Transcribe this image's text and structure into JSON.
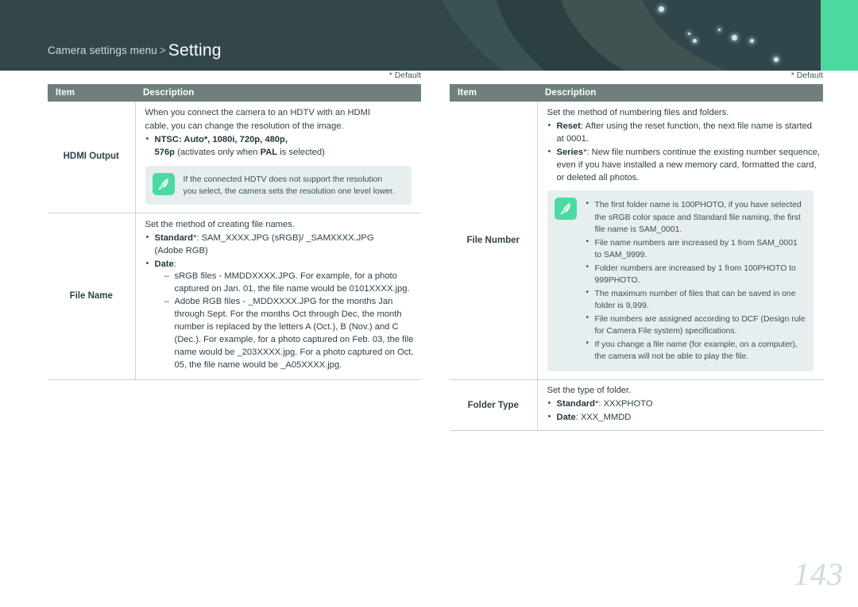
{
  "header": {
    "breadcrumb_prefix": "Camera settings menu",
    "breadcrumb_separator": ">",
    "title": "Setting",
    "accent_color": "#4cd9a0",
    "background_color": "#33474a"
  },
  "page_number": "143",
  "left_column": {
    "default_note": "* Default",
    "table": {
      "headers": {
        "item": "Item",
        "description": "Description"
      },
      "rows": [
        {
          "item": "HDMI Output",
          "intro_lines": [
            "When you connect the camera to an HDTV with an HDMI",
            "cable, you can change the resolution of the image."
          ],
          "bullets": [
            {
              "term": "NTSC",
              "text_a": ": ",
              "bold_values": "Auto*, 1080i, 720p, 480p,",
              "line2_bold": "576p",
              "line2_rest_a": " (activates only when ",
              "line2_bold_b": "PAL",
              "line2_rest_b": " is selected)"
            }
          ],
          "tip": {
            "icon": "pencil-note-icon",
            "lines": [
              "If the connected HDTV does not support the resolution",
              "you select, the camera sets the resolution one level lower."
            ]
          }
        },
        {
          "item": "File Name",
          "intro_lines": [
            "Set the method of creating file names."
          ],
          "bullet_standard_term": "Standard",
          "bullet_standard_text": "*: SAM_XXXX.JPG (sRGB)/ _SAMXXXX.JPG",
          "bullet_standard_line2": "(Adobe RGB)",
          "bullet_date_term": "Date",
          "bullet_date_colon": ":",
          "dashes": [
            "sRGB files - MMDDXXXX.JPG. For example, for a photo captured on Jan. 01, the file name would be 0101XXXX.jpg.",
            "Adobe RGB files - _MDDXXXX.JPG for the months Jan through Sept. For the months Oct through Dec, the month number is replaced by the letters A (Oct.), B (Nov.) and C (Dec.). For example, for a photo captured on Feb. 03, the file name would be _203XXXX.jpg. For a photo captured on Oct. 05, the file name would be _A05XXXX.jpg."
          ]
        }
      ]
    }
  },
  "right_column": {
    "default_note": "* Default",
    "table": {
      "headers": {
        "item": "Item",
        "description": "Description"
      },
      "rows": [
        {
          "item": "File Number",
          "intro_lines": [
            "Set the method of numbering files and folders."
          ],
          "bullet_reset_term": "Reset",
          "bullet_reset_text": ": After using the reset function, the next file name is started at 0001.",
          "bullet_series_term": "Series",
          "bullet_series_text": "*: New file numbers continue the existing number sequence, even if you have installed a new memory card, formatted the card, or deleted all photos.",
          "tip": {
            "icon": "pencil-note-icon",
            "bullets": [
              "The first folder name is 100PHOTO, if you have selected the sRGB color space and Standard file naming, the first file name is SAM_0001.",
              "File name numbers are increased by 1 from SAM_0001 to SAM_9999.",
              "Folder numbers are increased by 1 from 100PHOTO to 999PHOTO.",
              "The maximum number of files that can be saved in one folder is 9,999.",
              "File numbers are assigned according to DCF (Design rule for Camera File system) specifications.",
              "If you change a file name (for example, on a computer), the camera will not be able to play the file."
            ]
          }
        },
        {
          "item": "Folder Type",
          "intro_lines": [
            "Set the type of folder."
          ],
          "bullet_standard_term": "Standard",
          "bullet_standard_text": "*: XXXPHOTO",
          "bullet_date_term": "Date",
          "bullet_date_text": ": XXX_MMDD"
        }
      ]
    }
  }
}
